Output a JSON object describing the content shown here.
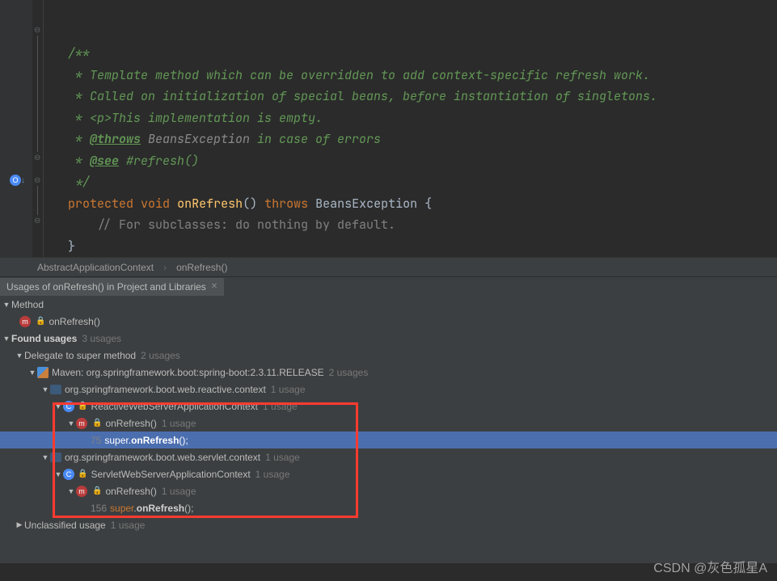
{
  "code": {
    "l1": "/**",
    "l2": " * Template method which can be overridden to add context-specific refresh work.",
    "l3": " * Called on initialization of special beans, before instantiation of singletons.",
    "l4_pre": " * ",
    "l4_tag_open": "<p>",
    "l4_text": "This implementation is empty.",
    "l5_pre": " * ",
    "l5_tag": "@throws",
    "l5_type": " BeansException",
    "l5_rest": " in case of errors",
    "l6_pre": " * ",
    "l6_tag": "@see",
    "l6_rest": " #refresh()",
    "l7": " */",
    "l8_kw1": "protected",
    "l8_kw2": "void",
    "l8_name": "onRefresh",
    "l8_paren": "()",
    "l8_kw3": "throws",
    "l8_type": "BeansException",
    "l8_brace": " {",
    "l9": "// For subclasses: do nothing by default.",
    "l10": "}"
  },
  "breadcrumb": {
    "class": "AbstractApplicationContext",
    "method": "onRefresh()"
  },
  "tool_tab": {
    "title": "Usages of onRefresh() in Project and Libraries"
  },
  "tree": {
    "method_header": "Method",
    "method_name": "onRefresh()",
    "found": "Found usages",
    "found_count": "3 usages",
    "delegate": "Delegate to super method",
    "delegate_count": "2 usages",
    "maven_label": "Maven: org.springframework.boot:spring-boot:2.3.11.RELEASE",
    "maven_count": "2 usages",
    "pkg1": "org.springframework.boot.web.reactive.context",
    "pkg1_count": "1 usage",
    "cls1": "ReactiveWebServerApplicationContext",
    "cls1_count": "1 usage",
    "m1": "onRefresh()",
    "m1_count": "1 usage",
    "line1_no": "75",
    "line1_super": "super",
    "line1_dot": ".",
    "line1_call": "onRefresh",
    "line1_end": "();",
    "pkg2": "org.springframework.boot.web.servlet.context",
    "pkg2_count": "1 usage",
    "cls2": "ServletWebServerApplicationContext",
    "cls2_count": "1 usage",
    "m2": "onRefresh()",
    "m2_count": "1 usage",
    "line2_no": "156",
    "line2_super": "super",
    "line2_dot": ".",
    "line2_call": "onRefresh",
    "line2_end": "();",
    "unclassified": "Unclassified usage",
    "unclassified_count": "1 usage"
  },
  "watermark": "CSDN @灰色孤星A"
}
